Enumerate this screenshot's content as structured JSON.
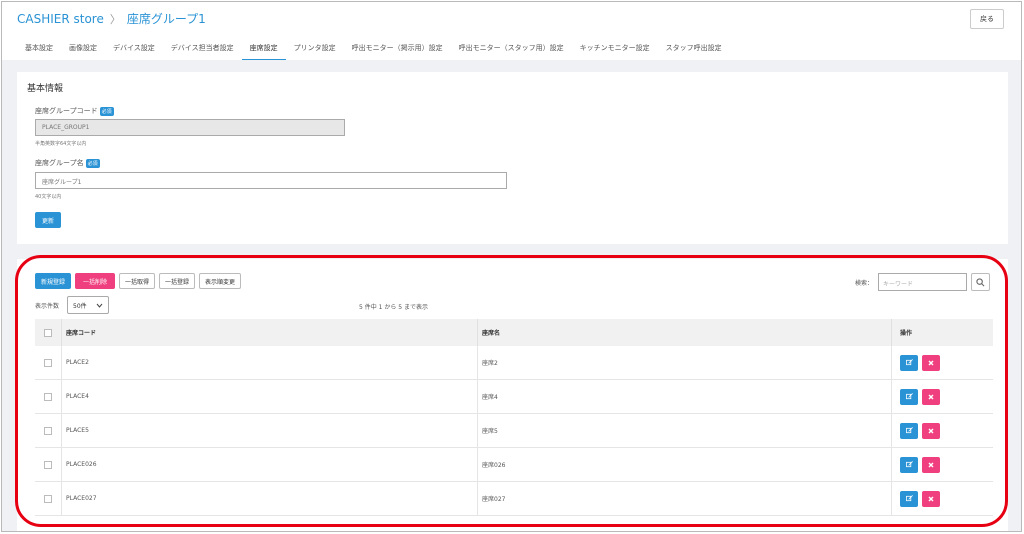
{
  "breadcrumb": {
    "store": "CASHIER store",
    "separator": "〉",
    "current": "座席グループ1"
  },
  "header": {
    "back_label": "戻る"
  },
  "tabs": [
    {
      "label": "基本設定"
    },
    {
      "label": "画像設定"
    },
    {
      "label": "デバイス設定"
    },
    {
      "label": "デバイス担当者設定"
    },
    {
      "label": "座席設定",
      "active": true
    },
    {
      "label": "プリンタ設定"
    },
    {
      "label": "呼出モニター（掲示用）設定"
    },
    {
      "label": "呼出モニター（スタッフ用）設定"
    },
    {
      "label": "キッチンモニター設定"
    },
    {
      "label": "スタッフ呼出設定"
    }
  ],
  "basic_info": {
    "title": "基本情報",
    "code_label": "座席グループコード",
    "required_badge": "必須",
    "code_value": "PLACE_GROUP1",
    "code_hint": "半角英数字64文字以内",
    "name_label": "座席グループ名",
    "name_value": "座席グループ1",
    "name_hint": "40文字以内",
    "update_label": "更新"
  },
  "list": {
    "buttons": {
      "new": "新規登録",
      "bulk_delete": "一括削除",
      "bulk_fetch": "一括取得",
      "bulk_register": "一括登録",
      "reorder": "表示順変更"
    },
    "search_label": "検索：",
    "search_placeholder": "キーワード",
    "count_label": "表示件数",
    "count_value": "50件",
    "summary": "5 件中 1 から 5 まで表示",
    "columns": {
      "code": "座席コード",
      "name": "座席名",
      "ops": "操作"
    },
    "rows": [
      {
        "code": "PLACE2",
        "name": "座席2"
      },
      {
        "code": "PLACE4",
        "name": "座席4"
      },
      {
        "code": "PLACE5",
        "name": "座席5"
      },
      {
        "code": "PLACE026",
        "name": "座席026"
      },
      {
        "code": "PLACE027",
        "name": "座席027"
      }
    ]
  },
  "colors": {
    "accent": "#2a93d5",
    "danger": "#ef3f7e",
    "highlight": "#e60012"
  }
}
